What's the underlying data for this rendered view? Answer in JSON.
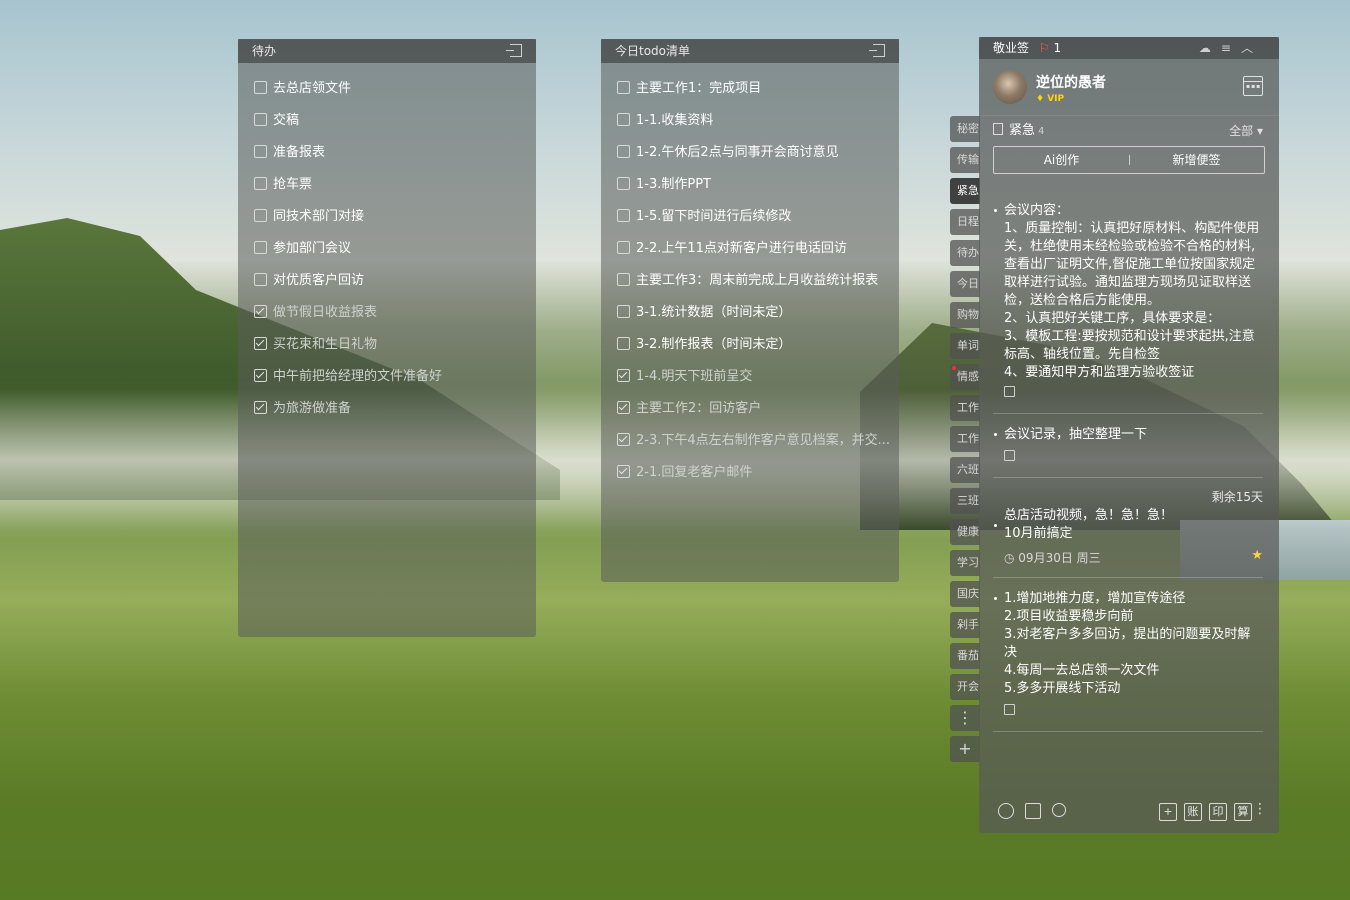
{
  "todo_panel": {
    "title": "待办",
    "items": [
      {
        "text": "去总店领文件",
        "done": false
      },
      {
        "text": "交稿",
        "done": false
      },
      {
        "text": "准备报表",
        "done": false
      },
      {
        "text": "抢车票",
        "done": false
      },
      {
        "text": "同技术部门对接",
        "done": false
      },
      {
        "text": "参加部门会议",
        "done": false
      },
      {
        "text": "对优质客户回访",
        "done": false
      },
      {
        "text": "做节假日收益报表",
        "done": true
      },
      {
        "text": "买花束和生日礼物",
        "done": true
      },
      {
        "text": "中午前把给经理的文件准备好",
        "done": true
      },
      {
        "text": "为旅游做准备",
        "done": true
      }
    ]
  },
  "today_panel": {
    "title": "今日todo清单",
    "items": [
      {
        "text": "主要工作1：完成项目",
        "done": false
      },
      {
        "text": "1-1.收集资料",
        "done": false
      },
      {
        "text": "1-2.午休后2点与同事开会商讨意见",
        "done": false
      },
      {
        "text": "1-3.制作PPT",
        "done": false
      },
      {
        "text": "1-5.留下时间进行后续修改",
        "done": false
      },
      {
        "text": "2-2.上午11点对新客户进行电话回访",
        "done": false
      },
      {
        "text": "主要工作3：周末前完成上月收益统计报表",
        "done": false
      },
      {
        "text": "3-1.统计数据（时间未定）",
        "done": false
      },
      {
        "text": "3-2.制作报表（时间未定）",
        "done": false
      },
      {
        "text": "1-4.明天下班前呈交",
        "done": true
      },
      {
        "text": "主要工作2：回访客户",
        "done": true
      },
      {
        "text": "2-3.下午4点左右制作客户意见档案，并交...",
        "done": true
      },
      {
        "text": "2-1.回复老客户邮件",
        "done": true
      }
    ]
  },
  "side_tabs": [
    "秘密",
    "传输",
    "紧急",
    "日程",
    "待办",
    "今日",
    "购物",
    "单词",
    "情感",
    "工作",
    "工作",
    "六班",
    "三班",
    "健康",
    "学习",
    "国庆",
    "剁手",
    "番茄",
    "开会"
  ],
  "side_tabs_active_index": 2,
  "side_tab_more": "⋮",
  "side_tab_add": "+",
  "note": {
    "app_name": "敬业签",
    "reminder_count": "1",
    "user": {
      "name": "逆位的愚者",
      "vip": "VIP"
    },
    "category": {
      "name": "紧急",
      "count": "4",
      "filter": "全部"
    },
    "actions": {
      "ai": "Ai创作",
      "new": "新增便签"
    },
    "items": [
      {
        "lines": [
          "会议内容：",
          "1、质量控制：认真把好原材料、构配件使用关，杜绝使用未经检验或检验不合格的材料,查看出厂证明文件,督促施工单位按国家规定取样进行试验。通知监理方现场见证取样送检，送检合格后方能使用。",
          "2、认真把好关键工序，具体要求是：",
          "3、模板工程:要按规范和设计要求起拱,注意标高、轴线位置。先自检签",
          "4、要通知甲方和监理方验收签证"
        ]
      },
      {
        "lines": [
          "会议记录，抽空整理一下"
        ]
      },
      {
        "remaining": "剩余15天",
        "lines": [
          "总店活动视频，急！急！急！",
          "10月前搞定"
        ],
        "date": "09月30日 周三"
      },
      {
        "lines": [
          "1.增加地推力度，增加宣传途径",
          "2.项目收益要稳步向前",
          "3.对老客户多多回访，提出的问题要及时解决",
          "4.每周一去总店领一次文件",
          "5.多多开展线下活动"
        ]
      }
    ],
    "bottom_buttons": {
      "add": "+",
      "account": "账",
      "print": "印",
      "calc": "算"
    }
  }
}
